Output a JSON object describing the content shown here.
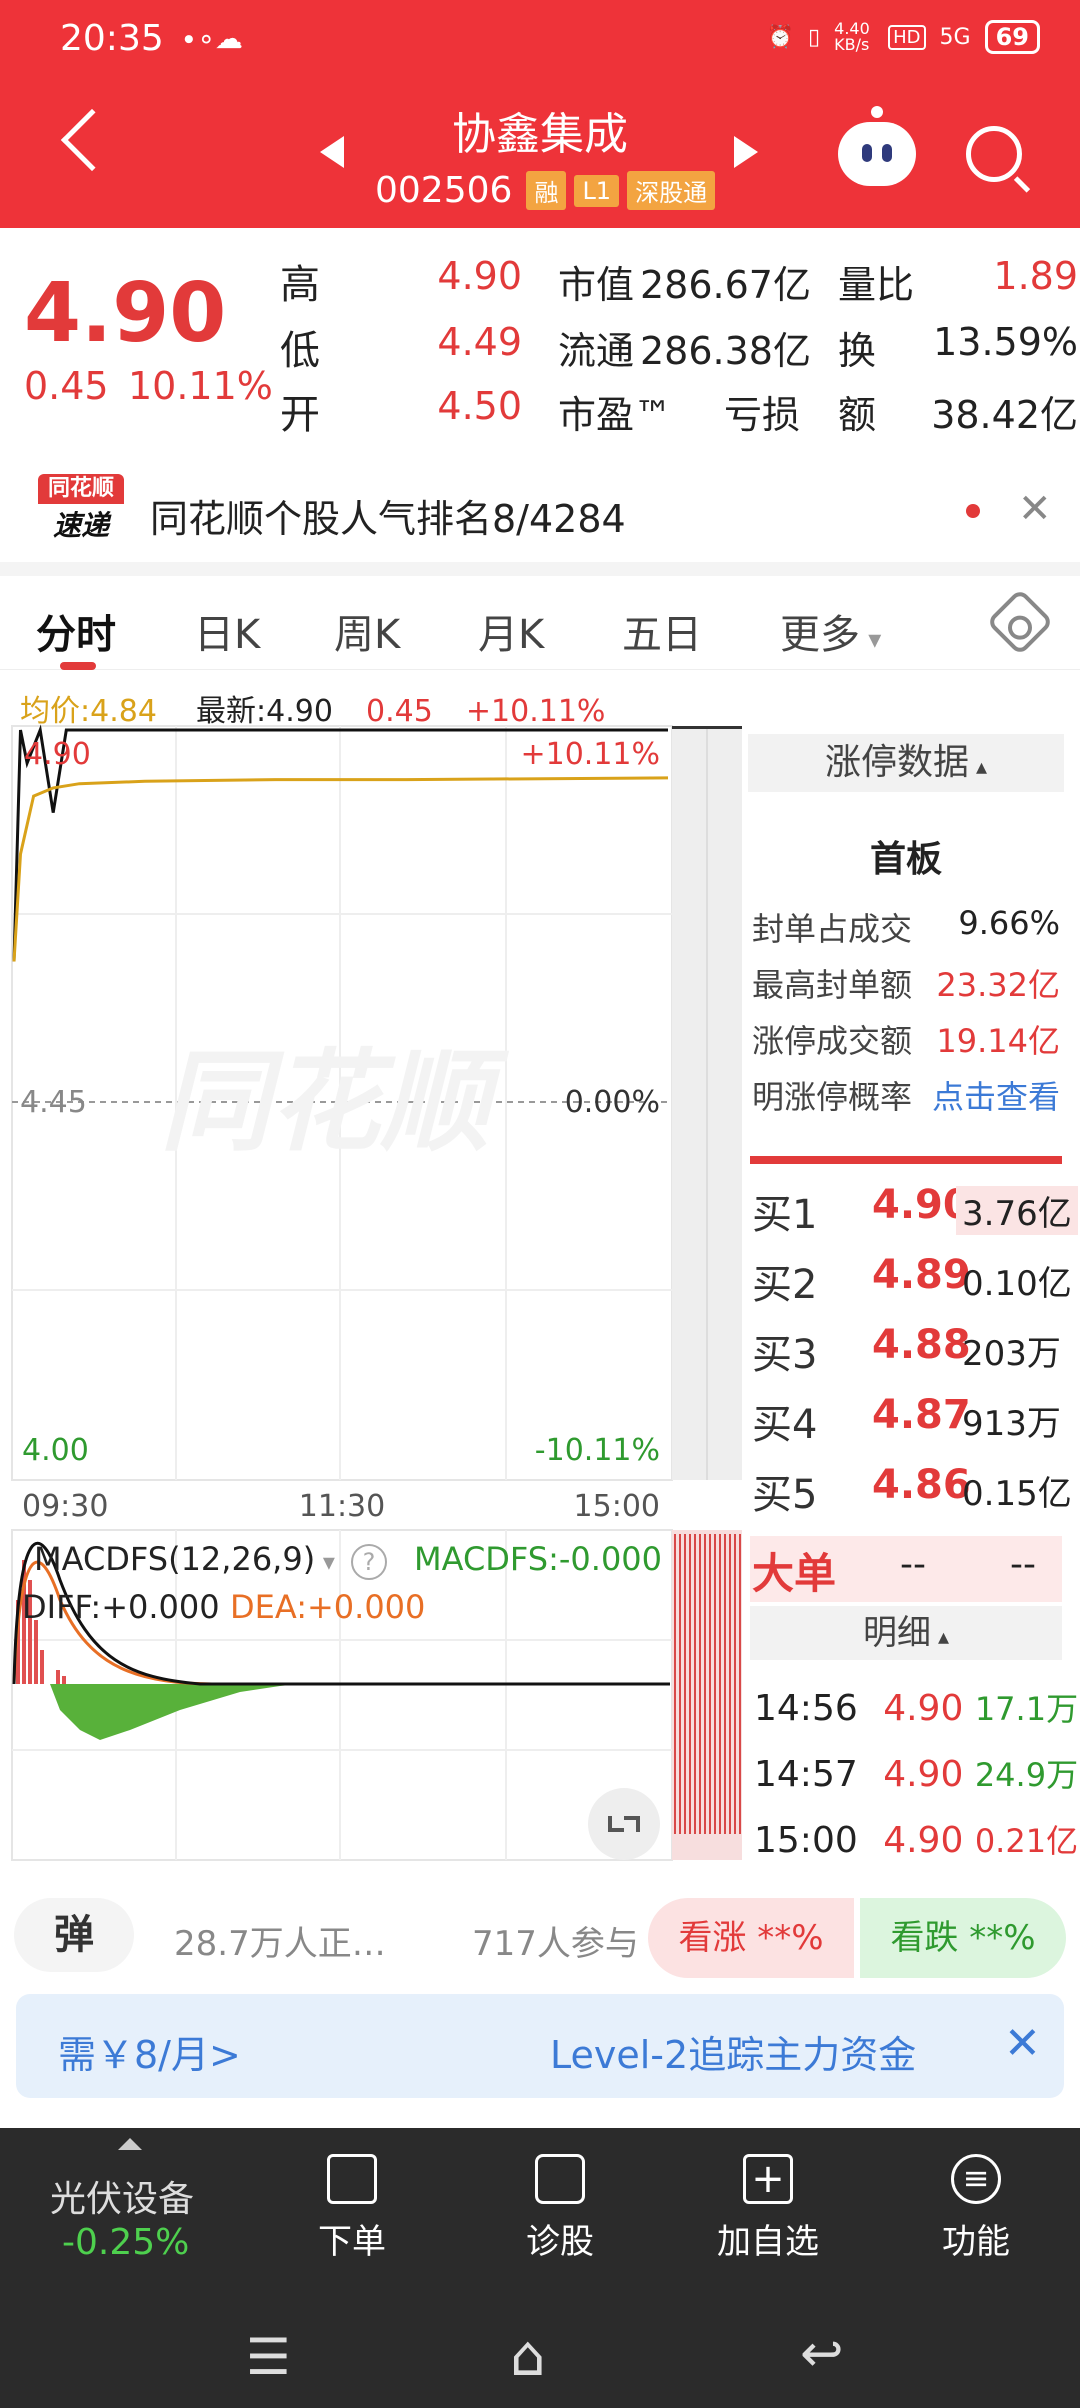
{
  "status_bar": {
    "time": "20:35",
    "net_speed": "4.40 KB/s",
    "signal": "5G",
    "battery": "69"
  },
  "header": {
    "title": "协鑫集成",
    "code": "002506",
    "tags": [
      "融",
      "L1",
      "深股通"
    ]
  },
  "quote": {
    "price": "4.90",
    "change": "0.45",
    "change_pct": "10.11%",
    "rows": [
      {
        "label": "高",
        "value": "4.90",
        "k1": "市值",
        "v1": "286.67亿",
        "k2": "量比",
        "v2": "1.89"
      },
      {
        "label": "低",
        "value": "4.49",
        "k1": "流通",
        "v1": "286.38亿",
        "k2": "换",
        "v2": "13.59%"
      },
      {
        "label": "开",
        "value": "4.50",
        "k1": "市盈™",
        "v1": "亏损",
        "k2": "额",
        "v2": "38.42亿"
      }
    ]
  },
  "news": {
    "logo_top": "同花顺",
    "logo_bottom": "速递",
    "text": "同花顺个股人气排名8/4284"
  },
  "tabs": [
    "分时",
    "日K",
    "周K",
    "月K",
    "五日",
    "更多"
  ],
  "info_line": {
    "avg_label": "均价:4.84",
    "latest_label": "最新:4.90",
    "chg": "0.45",
    "chg_pct": "+10.11%"
  },
  "chart_data": {
    "type": "line",
    "title": "",
    "y_labels": {
      "top_left": "4.90",
      "top_right": "+10.11%",
      "mid_left": "4.45",
      "mid_right": "0.00%",
      "bottom_left": "4.00",
      "bottom_right": "-10.11%"
    },
    "x_labels": [
      "09:30",
      "11:30",
      "15:00"
    ],
    "ylim": [
      4.0,
      4.9
    ],
    "watermark": "同花顺",
    "series": [
      {
        "color": "#111111",
        "x": [
          0,
          0.01,
          0.02,
          0.04,
          0.06,
          0.08,
          0.1,
          0.15,
          0.3,
          0.5,
          1.0
        ],
        "values": [
          4.62,
          4.9,
          4.86,
          4.9,
          4.8,
          4.9,
          4.9,
          4.9,
          4.9,
          4.9,
          4.9
        ]
      },
      {
        "color": "#d9a21a",
        "x": [
          0,
          0.01,
          0.03,
          0.06,
          0.1,
          0.2,
          0.4,
          0.6,
          1.0
        ],
        "values": [
          4.62,
          4.75,
          4.82,
          4.83,
          4.835,
          4.838,
          4.84,
          4.84,
          4.842
        ]
      }
    ]
  },
  "macd": {
    "label": "MACDFS(12,26,9)",
    "macdfs": "MACDFS:-0.000",
    "diff": "DIFF:+0.000",
    "dea": "DEA:+0.000",
    "scale": "0.10"
  },
  "limit_up": {
    "header": "涨停数据",
    "title": "首板",
    "items": [
      {
        "label": "封单占成交",
        "value": "9.66%"
      },
      {
        "label": "最高封单额",
        "value": "23.32亿"
      },
      {
        "label": "涨停成交额",
        "value": "19.14亿"
      },
      {
        "label": "明涨停概率",
        "value": "点击查看"
      }
    ]
  },
  "order_book": [
    {
      "label": "买1",
      "price": "4.90",
      "vol": "3.76亿"
    },
    {
      "label": "买2",
      "price": "4.89",
      "vol": "0.10亿"
    },
    {
      "label": "买3",
      "price": "4.88",
      "vol": "203万"
    },
    {
      "label": "买4",
      "price": "4.87",
      "vol": "913万"
    },
    {
      "label": "买5",
      "price": "4.86",
      "vol": "0.15亿"
    }
  ],
  "big_order": {
    "label": "大单",
    "v1": "--",
    "v2": "--"
  },
  "detail": {
    "header": "明细",
    "ticks": [
      {
        "time": "14:56",
        "price": "4.90",
        "vol": "17.1万"
      },
      {
        "time": "14:57",
        "price": "4.90",
        "vol": "24.9万"
      },
      {
        "time": "15:00",
        "price": "4.90",
        "vol": "0.21亿"
      }
    ]
  },
  "social": {
    "bubble": "弹",
    "watching": "28.7万人正…",
    "participants": "717人参与",
    "up": "看涨 **%",
    "down": "看跌 **%"
  },
  "promo": {
    "left": "需￥8/月>",
    "right": "Level-2追踪主力资金"
  },
  "bottom_nav": {
    "sector": "光伏设备",
    "sector_chg": "-0.25%",
    "items": [
      "下单",
      "诊股",
      "加自选",
      "功能"
    ]
  }
}
